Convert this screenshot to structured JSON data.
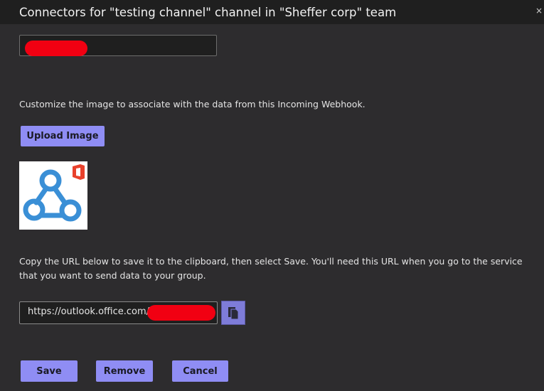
{
  "dialog": {
    "title": "Connectors for \"testing channel\" channel in \"Sheffer corp\" team",
    "close_glyph": "×"
  },
  "image_section": {
    "description": "Customize the image to associate with the data from this Incoming Webhook.",
    "upload_label": "Upload Image",
    "image_icon": "webhook-office-icon"
  },
  "url_section": {
    "instructions": "Copy the URL below to save it to the clipboard, then select Save. You'll need this URL when you go to the service that you want to send data to your group.",
    "url_prefix": "https://outlook.office.com/",
    "copy_icon": "copy-icon"
  },
  "footer": {
    "save_label": "Save",
    "remove_label": "Remove",
    "cancel_label": "Cancel"
  },
  "colors": {
    "accent": "#8f8df4",
    "background": "#2d2c2e",
    "redaction": "#f10012"
  }
}
